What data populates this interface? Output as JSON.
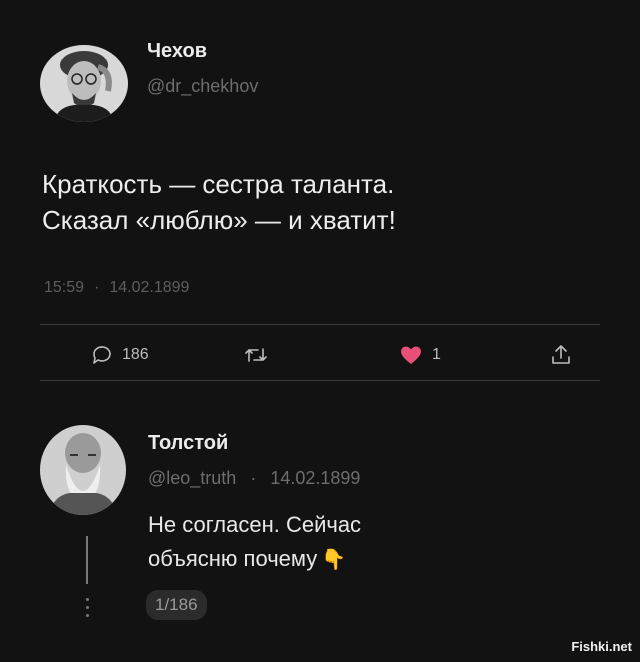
{
  "tweet": {
    "author_name": "Чехов",
    "author_handle": "@dr_chekhov",
    "text_line1": "Краткость — сестра таланта.",
    "text_line2": "Сказал «люблю» — и хватит!",
    "time": "15:59",
    "date": "14.02.1899",
    "separator": "·",
    "actions": {
      "reply_count": "186",
      "like_count": "1",
      "like_color": "#e8507a"
    }
  },
  "reply": {
    "author_name": "Толстой",
    "author_handle": "@leo_truth",
    "separator": "·",
    "date": "14.02.1899",
    "text_line1": "Не согласен. Сейчас",
    "text_line2": "объясню почему",
    "emoji": "👇",
    "thread_counter": "1/186"
  },
  "watermark": "Fishki.net",
  "icons": {
    "reply": "comment-bubble-icon",
    "retweet": "retweet-icon",
    "like": "heart-icon",
    "share": "share-icon"
  }
}
